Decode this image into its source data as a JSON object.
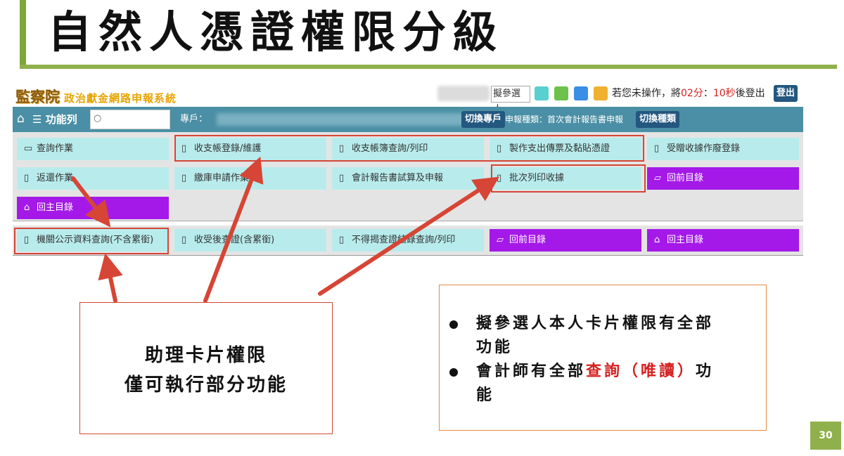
{
  "slide": {
    "title": "自然人憑證權限分級",
    "page_number": "30"
  },
  "app": {
    "logo_org": "監察院",
    "logo_system": "政治獻金網路申報系統",
    "user_select": "擬參選人",
    "theme_colors": [
      "#59cfd0",
      "#6cc24a",
      "#3a8ee6",
      "#f0b030"
    ],
    "timeout_prefix": "若您未操作，將",
    "timeout_min": "02分",
    "timeout_sep": "：",
    "timeout_sec": "10秒",
    "timeout_suffix": "後登出",
    "logout": "登出"
  },
  "navbar": {
    "menu_label": "功能列",
    "account_label": "專戶：",
    "switch_account": "切換專戶",
    "report_type": "申報種類：首次會計報告書申報",
    "switch_type": "切換種類"
  },
  "menu_rows": {
    "row1": [
      {
        "label": "查詢作業",
        "icon": "folder-icon"
      },
      {
        "label": "收支帳登錄/維護",
        "icon": "file-icon"
      },
      {
        "label": "收支帳簿查詢/列印",
        "icon": "file-icon"
      },
      {
        "label": "製作支出傳票及黏貼憑證",
        "icon": "file-icon"
      },
      {
        "label": "受贈收據作廢登錄",
        "icon": "file-icon"
      }
    ],
    "row2": [
      {
        "label": "返還作業",
        "icon": "file-icon"
      },
      {
        "label": "繳庫申請作業",
        "icon": "file-icon"
      },
      {
        "label": "會計報告書試算及申報",
        "icon": "file-icon"
      },
      {
        "label": "批次列印收據",
        "icon": "file-icon"
      },
      {
        "label": "回前目錄",
        "icon": "folder-open-icon"
      }
    ],
    "row3": [
      {
        "label": "回主目錄",
        "icon": "home-icon"
      }
    ],
    "row4": [
      {
        "label": "機關公示資料查詢(不含累銜)",
        "icon": "file-icon"
      },
      {
        "label": "收受後查證(含累銜)",
        "icon": "file-icon"
      },
      {
        "label": "不得揭查證結錄查詢/列印",
        "icon": "file-icon"
      },
      {
        "label": "回前目錄",
        "icon": "folder-open-icon"
      },
      {
        "label": "回主目錄",
        "icon": "home-icon"
      }
    ]
  },
  "callout_assistant": {
    "line1": "助理卡片權限",
    "line2": "僅可執行部分功能"
  },
  "callout_roles": {
    "b1_line1": "擬參選人本人卡片權限有全部",
    "b1_line2": "功能",
    "b2_prefix": "會計師有全部",
    "b2_highlight": "查詢（唯讀）",
    "b2_suffix": "功",
    "b2_line2": "能"
  }
}
